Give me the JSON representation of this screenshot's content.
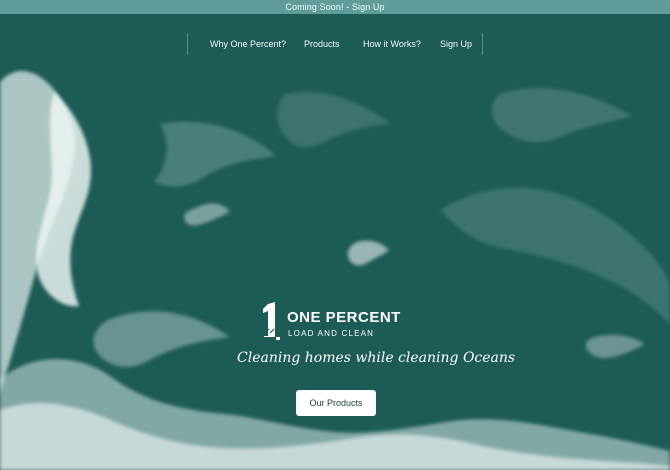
{
  "banner": {
    "text": "Coming Soon! - Sign Up"
  },
  "nav": {
    "items": [
      {
        "label": "Why One Percent?"
      },
      {
        "label": "Products"
      },
      {
        "label": "How it Works?"
      },
      {
        "label": "Sign Up"
      }
    ]
  },
  "hero": {
    "logo": {
      "mark": "1",
      "title": "ONE PERCENT",
      "subtitle": "LOAD AND CLEAN"
    },
    "tagline": "Cleaning homes while cleaning Oceans",
    "cta_label": "Our Products"
  },
  "colors": {
    "banner": "#5f9c9a",
    "ocean": "#1f5e5a",
    "button": "#ffffff",
    "text": "#ffffff"
  },
  "icons": {
    "logo": "one-percent-logo-icon"
  }
}
